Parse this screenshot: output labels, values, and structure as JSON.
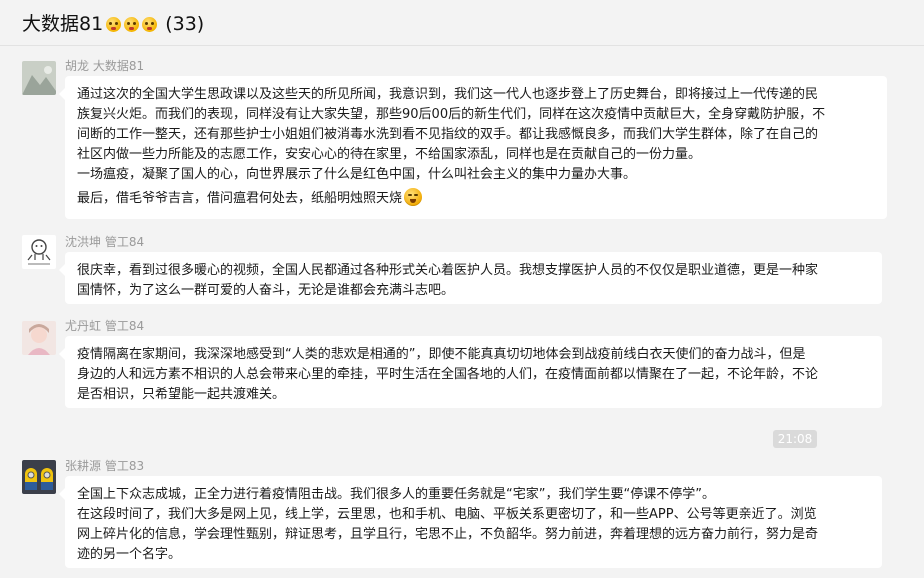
{
  "header": {
    "title": "大数据81",
    "count": "(33)"
  },
  "messages": [
    {
      "sender": "胡龙 大数据81",
      "lines": [
        "通过这次的全国大学生思政课以及这些天的所见所闻，我意识到，我们这一代人也逐步登上了历史舞台，即将接过上一代传递的民",
        "族复兴火炬。而我们的表现，同样没有让大家失望，那些90后00后的新生代们，同样在这次疫情中贡献巨大，全身穿戴防护服，不",
        "间断的工作一整天，还有那些护士小姐姐们被消毒水洗到看不见指纹的双手。都让我感慨良多，而我们大学生群体，除了在自己的",
        "社区内做一些力所能及的志愿工作，安安心心的待在家里，不给国家添乱，同样也是在贡献自己的一份力量。",
        "一场瘟疫，凝聚了国人的心，向世界展示了什么是红色中国，什么叫社会主义的集中力量办大事。",
        "最后，借毛爷爷吉言，借问瘟君何处去，纸船明烛照天烧"
      ]
    },
    {
      "sender": "沈洪坤 管工84",
      "lines": [
        "很庆幸，看到过很多暖心的视频，全国人民都通过各种形式关心着医护人员。我想支撑医护人员的不仅仅是职业道德，更是一种家",
        "国情怀，为了这么一群可爱的人奋斗，无论是谁都会充满斗志吧。"
      ]
    },
    {
      "sender": "尤丹虹 管工84",
      "lines": [
        "疫情隔离在家期间，我深深地感受到“人类的悲欢是相通的”，即使不能真真切切地体会到战疫前线白衣天使们的奋力战斗，但是",
        "身边的人和远方素不相识的人总会带来心里的牵挂，平时生活在全国各地的人们，在疫情面前都以情聚在了一起，不论年龄，不论",
        "是否相识，只希望能一起共渡难关。"
      ]
    },
    {
      "sender": "张耕源 管工83",
      "lines": [
        "全国上下众志成城，正全力进行着疫情阻击战。我们很多人的重要任务就是“宅家”，我们学生要“停课不停学”。",
        "在这段时间了，我们大多是网上见，线上学，云里思，也和手机、电脑、平板关系更密切了，和一些APP、公号等更亲近了。浏览",
        "网上碎片化的信息，学会理性甄别，辩证思考，且学且行，宅思不止，不负韶华。努力前进，奔着理想的远方奋力前行，努力是奇",
        "迹的另一个名字。"
      ]
    }
  ],
  "timestamp": "21:08"
}
